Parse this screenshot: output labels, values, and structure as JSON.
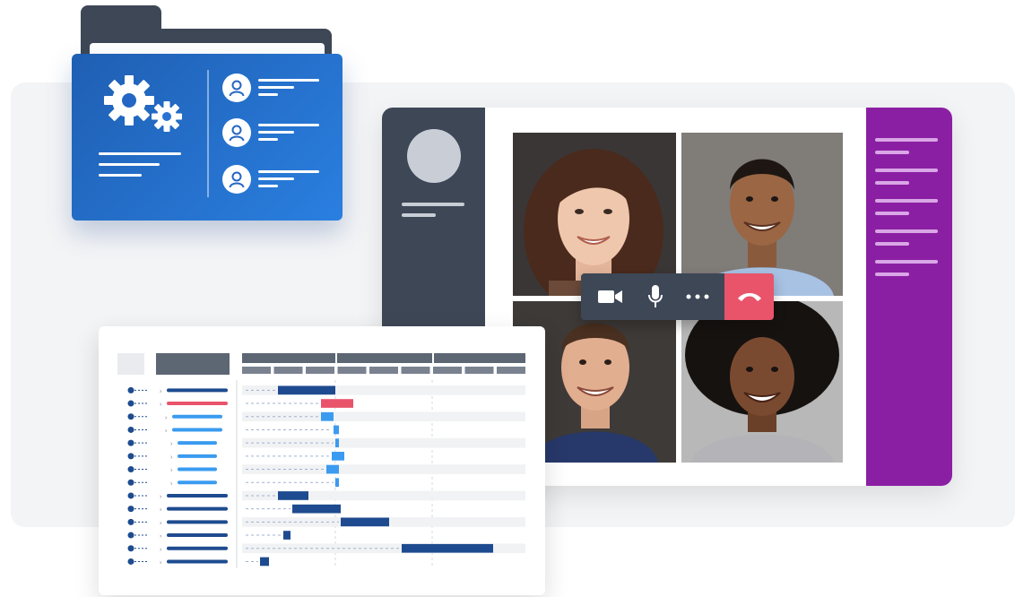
{
  "folder": {
    "icon": "gears-icon",
    "users": [
      {
        "icon": "user-icon"
      },
      {
        "icon": "user-icon"
      },
      {
        "icon": "user-icon"
      }
    ]
  },
  "call": {
    "participants": [
      {
        "name": "",
        "photo": "woman-curly-hair"
      },
      {
        "name": "",
        "photo": "man-smiling"
      },
      {
        "name": "",
        "photo": "man-smiling-beard"
      },
      {
        "name": "",
        "photo": "woman-afro-hair"
      }
    ],
    "controls": [
      {
        "id": "camera",
        "icon": "video-camera-icon"
      },
      {
        "id": "mic",
        "icon": "microphone-icon"
      },
      {
        "id": "more",
        "icon": "more-dots-icon"
      },
      {
        "id": "end",
        "icon": "hang-up-icon"
      }
    ],
    "colors": {
      "sidebar_left": "#3d4756",
      "sidebar_right": "#8b1fa3",
      "end_call": "#e9546b"
    }
  },
  "gantt": {
    "colors": {
      "bar": "#1e4b8f",
      "highlight": "#e9546b",
      "subtask": "#3a9bf0"
    },
    "rows": [
      {
        "indent": 0,
        "kind": "task"
      },
      {
        "indent": 0,
        "kind": "critical"
      },
      {
        "indent": 1,
        "kind": "subtask"
      },
      {
        "indent": 1,
        "kind": "subtask"
      },
      {
        "indent": 2,
        "kind": "subtask"
      },
      {
        "indent": 2,
        "kind": "subtask"
      },
      {
        "indent": 2,
        "kind": "subtask"
      },
      {
        "indent": 2,
        "kind": "subtask"
      },
      {
        "indent": 0,
        "kind": "task"
      },
      {
        "indent": 0,
        "kind": "task"
      },
      {
        "indent": 0,
        "kind": "task"
      },
      {
        "indent": 0,
        "kind": "task"
      },
      {
        "indent": 0,
        "kind": "task"
      },
      {
        "indent": 0,
        "kind": "task"
      }
    ]
  }
}
